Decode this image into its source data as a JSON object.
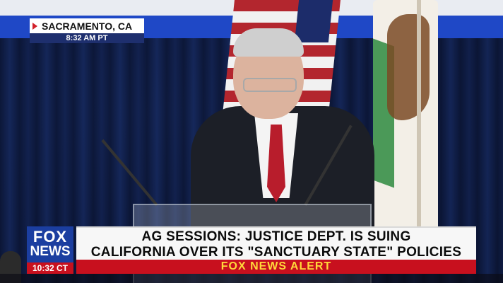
{
  "location": {
    "city": "SACRAMENTO, CA",
    "time": "8:32 AM PT"
  },
  "logo": {
    "line1": "FOX",
    "line2": "NEWS",
    "clock": "10:32 CT"
  },
  "headline": {
    "line1": "AG SESSIONS: JUSTICE DEPT. IS SUING",
    "line2": "CALIFORNIA OVER ITS \"SANCTUARY STATE\" POLICIES"
  },
  "alert": {
    "label": "FOX NEWS ALERT"
  },
  "colors": {
    "brand_blue": "#1b3ea0",
    "alert_red": "#c8101e",
    "alert_text": "#ffd83a"
  }
}
